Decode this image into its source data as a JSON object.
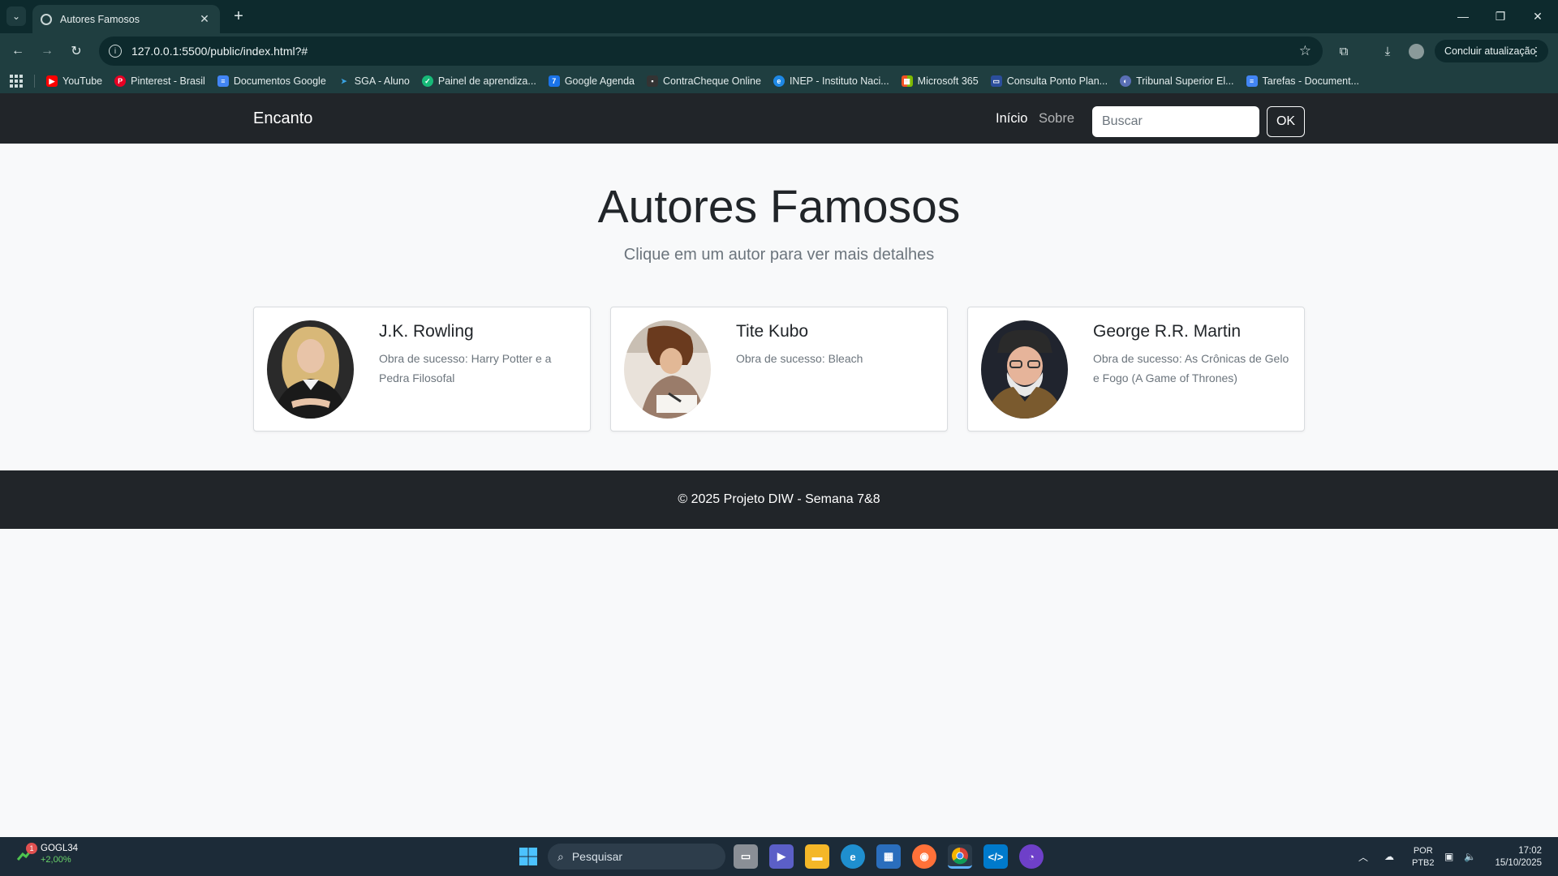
{
  "browser": {
    "tab_title": "Autores Famosos",
    "url": "127.0.0.1:5500/public/index.html?#",
    "update_button": "Concluir atualização",
    "bookmarks": [
      {
        "label": "YouTube",
        "icon": "youtube-icon",
        "color": "#ff0000"
      },
      {
        "label": "Pinterest - Brasil",
        "icon": "pinterest-icon",
        "color": "#e60023"
      },
      {
        "label": "Documentos Google",
        "icon": "google-docs-icon",
        "color": "#4285f4"
      },
      {
        "label": "SGA - Aluno",
        "icon": "sga-icon",
        "color": "#3aa3e3"
      },
      {
        "label": "Painel de aprendiza...",
        "icon": "learning-panel-icon",
        "color": "#17b978"
      },
      {
        "label": "Google Agenda",
        "icon": "google-calendar-icon",
        "color": "#1a73e8"
      },
      {
        "label": "ContraCheque Online",
        "icon": "contracheque-icon",
        "color": "#333333"
      },
      {
        "label": "INEP - Instituto Naci...",
        "icon": "inep-icon",
        "color": "#1e88e5"
      },
      {
        "label": "Microsoft 365",
        "icon": "microsoft-icon",
        "color": "#f25022"
      },
      {
        "label": "Consulta Ponto Plan...",
        "icon": "consulta-ponto-icon",
        "color": "#2b4e9c"
      },
      {
        "label": "Tribunal Superior El...",
        "icon": "tse-icon",
        "color": "#5a6fb5"
      },
      {
        "label": "Tarefas - Document...",
        "icon": "tasks-doc-icon",
        "color": "#4285f4"
      }
    ]
  },
  "site": {
    "brand": "Encanto",
    "nav": {
      "home": "Início",
      "about": "Sobre"
    },
    "search": {
      "placeholder": "Buscar",
      "button": "OK"
    },
    "hero": {
      "title": "Autores Famosos",
      "subtitle": "Clique em um autor para ver mais detalhes"
    },
    "authors": [
      {
        "name": "J.K. Rowling",
        "work": "Obra de sucesso: Harry Potter e a Pedra Filosofal"
      },
      {
        "name": "Tite Kubo",
        "work": "Obra de sucesso: Bleach"
      },
      {
        "name": "George R.R. Martin",
        "work": "Obra de sucesso: As Crônicas de Gelo e Fogo (A Game of Thrones)"
      }
    ],
    "footer": "© 2025 Projeto DIW - Semana 7&8"
  },
  "taskbar": {
    "stock": {
      "symbol": "GOGL34",
      "change": "+2,00%",
      "badge": "1"
    },
    "search_placeholder": "Pesquisar",
    "lang": {
      "line1": "POR",
      "line2": "PTB2"
    },
    "clock": {
      "time": "17:02",
      "date": "15/10/2025"
    }
  }
}
